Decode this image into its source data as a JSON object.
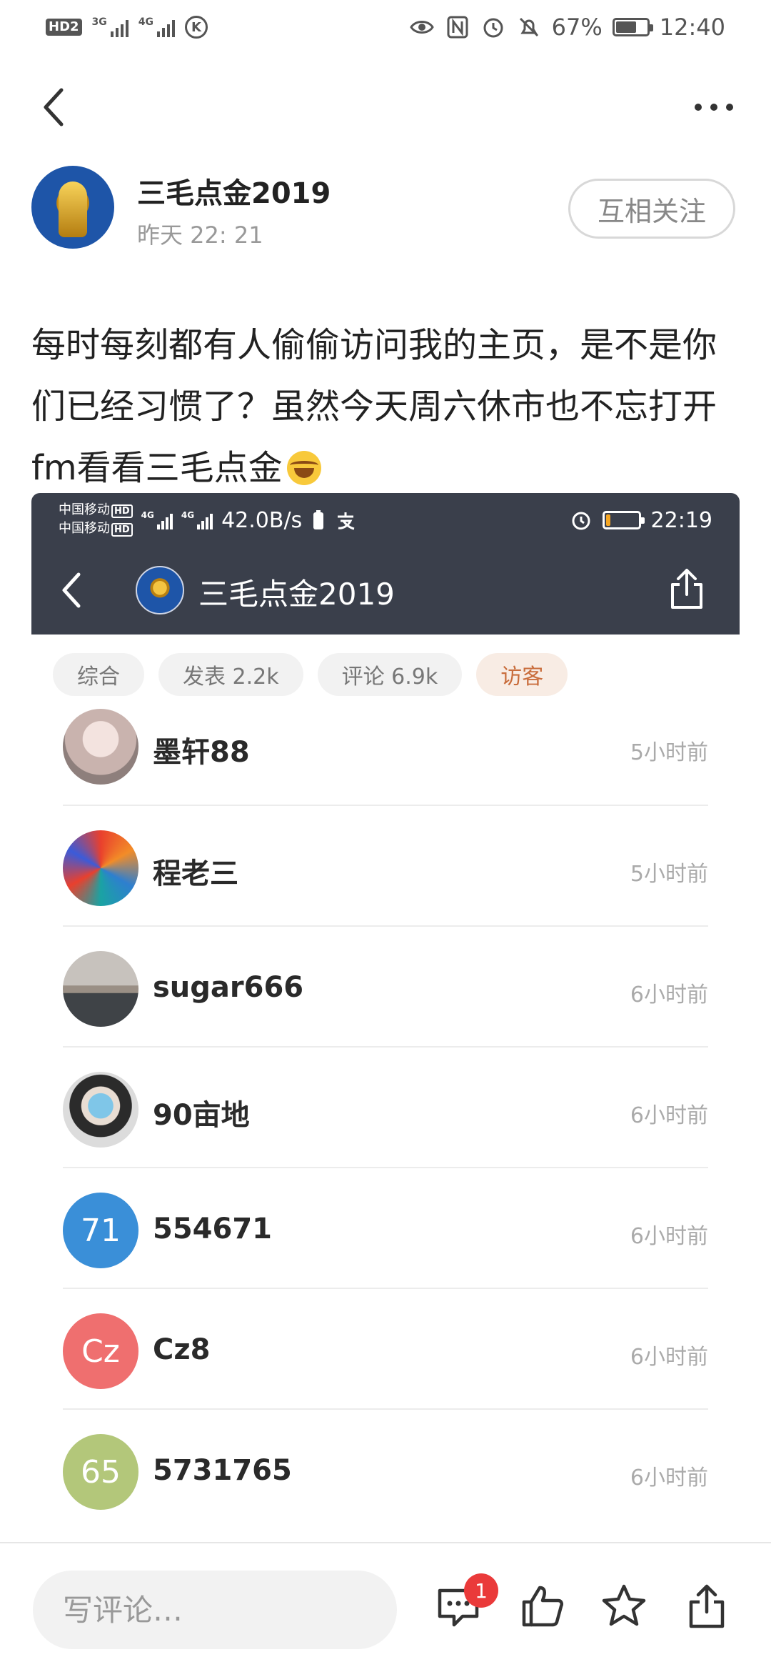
{
  "status_bar": {
    "hd_label": "HD",
    "hd_sub": "2",
    "net1": "3G",
    "net2": "4G",
    "k_label": "K",
    "battery_percent": "67%",
    "battery_level": 0.67,
    "time": "12:40",
    "icons": [
      "eye-icon",
      "nfc-icon",
      "alarm-icon",
      "mute-bell-icon",
      "battery-icon"
    ]
  },
  "nav": {
    "back_icon": "chevron-left-icon",
    "more_icon": "more-dots-icon"
  },
  "author": {
    "name": "三毛点金2019",
    "time": "昨天 22: 21",
    "follow_label": "互相关注"
  },
  "post": {
    "text": "每时每刻都有人偷偷访问我的主页，是不是你们已经习惯了？虽然今天周六休市也不忘打开fm看看三毛点金",
    "emoji": "laughing-tears-emoji"
  },
  "screenshot": {
    "status": {
      "carrier1": "中国移动",
      "carrier2": "中国移动",
      "hd": "HD",
      "net": "4G",
      "speed": "42.0B/s",
      "time": "22:19",
      "battery_level": 0.15
    },
    "title": "三毛点金2019",
    "tabs": [
      {
        "label": "综合",
        "active": false
      },
      {
        "label": "发表 2.2k",
        "active": false
      },
      {
        "label": "评论 6.9k",
        "active": false
      },
      {
        "label": "访客",
        "active": true
      }
    ],
    "visitors": [
      {
        "name": "墨轩88",
        "time": "5小时前",
        "avatar_text": "",
        "avatar_color": "#d9c9c6"
      },
      {
        "name": "程老三",
        "time": "5小时前",
        "avatar_text": "",
        "avatar_color": "#2e7fcf"
      },
      {
        "name": "sugar666",
        "time": "6小时前",
        "avatar_text": "",
        "avatar_color": "#6b7075"
      },
      {
        "name": "90亩地",
        "time": "6小时前",
        "avatar_text": "",
        "avatar_color": "#cfd3d6"
      },
      {
        "name": "554671",
        "time": "6小时前",
        "avatar_text": "71",
        "avatar_color": "#3a8fd8"
      },
      {
        "name": "Cz8",
        "time": "6小时前",
        "avatar_text": "Cz",
        "avatar_color": "#ef6f6f"
      },
      {
        "name": "5731765",
        "time": "6小时前",
        "avatar_text": "65",
        "avatar_color": "#b3c77a"
      }
    ]
  },
  "bottom_bar": {
    "comment_placeholder": "写评论…",
    "comment_badge": "1",
    "icons": [
      "comment-icon",
      "like-icon",
      "star-icon",
      "share-icon"
    ]
  }
}
